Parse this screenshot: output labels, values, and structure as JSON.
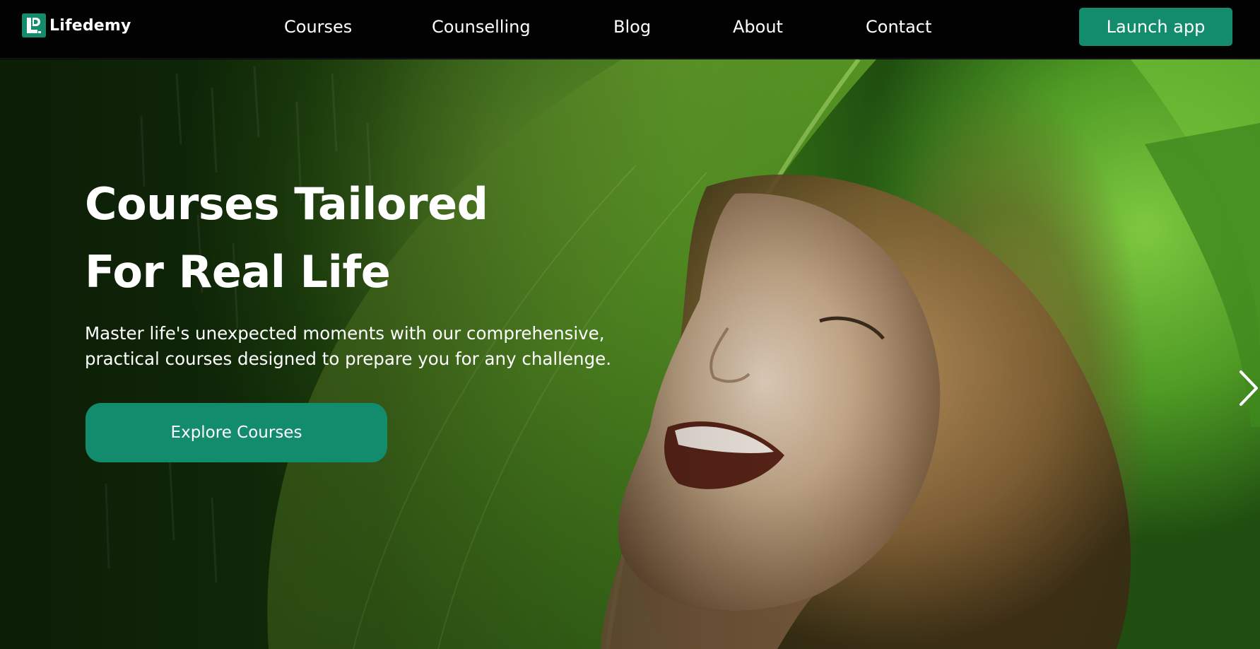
{
  "brand": {
    "name": "Lifedemy",
    "logo_icon": "lifedemy-logo-icon",
    "accent_color": "#138c6e"
  },
  "nav": {
    "items": [
      {
        "label": "Courses"
      },
      {
        "label": "Counselling"
      },
      {
        "label": "Blog"
      },
      {
        "label": "About"
      },
      {
        "label": "Contact"
      }
    ],
    "cta_label": "Launch app"
  },
  "hero": {
    "title_lines": [
      "Courses Tailored",
      "For Real Life"
    ],
    "subtitle_lines": [
      "Master life's unexpected moments with our comprehensive,",
      "practical courses designed to prepare you for any challenge."
    ],
    "cta_label": "Explore Courses",
    "next_icon": "chevron-right-icon"
  }
}
